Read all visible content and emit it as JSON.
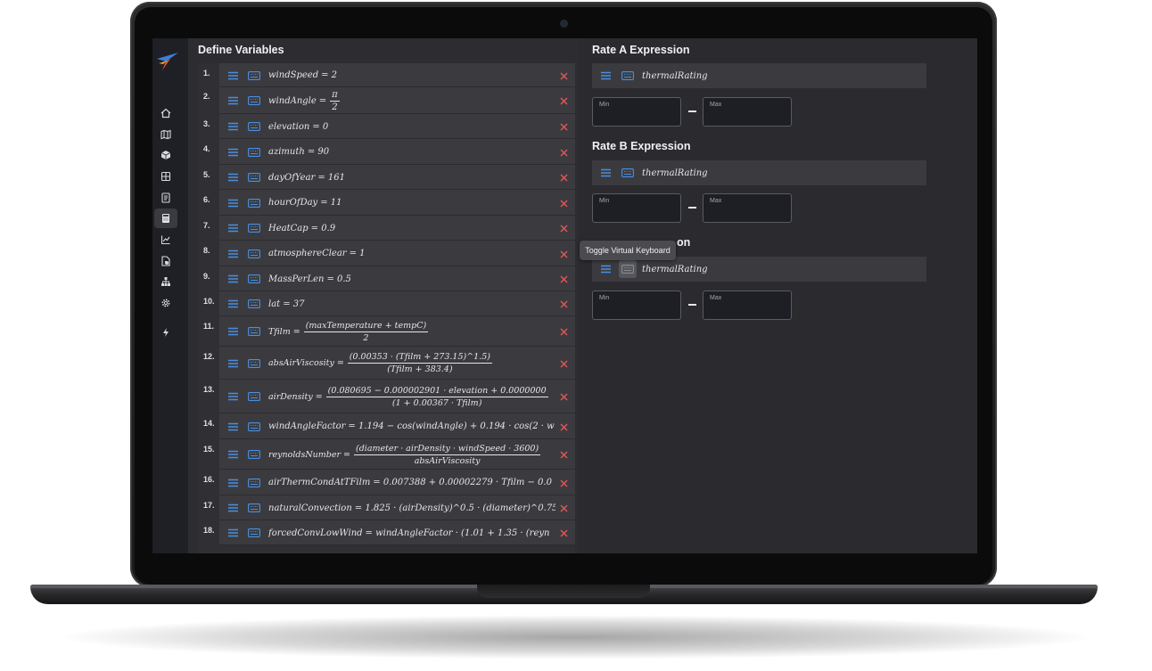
{
  "define_variables_title": "Define Variables",
  "variables": [
    {
      "num": "1.",
      "lhs": "windSpeed",
      "rhs": "= 2"
    },
    {
      "num": "2.",
      "lhs": "windAngle",
      "frac_num": "π",
      "frac_den": "2"
    },
    {
      "num": "3.",
      "lhs": "elevation",
      "rhs": "= 0"
    },
    {
      "num": "4.",
      "lhs": "azimuth",
      "rhs": "= 90"
    },
    {
      "num": "5.",
      "lhs": "dayOfYear",
      "rhs": "= 161"
    },
    {
      "num": "6.",
      "lhs": "hourOfDay",
      "rhs": "= 11"
    },
    {
      "num": "7.",
      "lhs": "HeatCap",
      "rhs": "= 0.9"
    },
    {
      "num": "8.",
      "lhs": "atmosphereClear",
      "rhs": "= 1"
    },
    {
      "num": "9.",
      "lhs": "MassPerLen",
      "rhs": "= 0.5"
    },
    {
      "num": "10.",
      "lhs": "lat",
      "rhs": "= 37"
    },
    {
      "num": "11.",
      "lhs": "Tfilm",
      "frac_num": "(maxTemperature + tempC)",
      "frac_den": "2"
    },
    {
      "num": "12.",
      "lhs": "absAirViscosity",
      "frac_num": "(0.00353 · (Tfilm + 273.15)^1.5)",
      "frac_den": "(Tfilm + 383.4)"
    },
    {
      "num": "13.",
      "lhs": "airDensity",
      "frac_num": "(0.080695 − 0.000002901 · elevation + 0.0000000",
      "frac_den": "(1 + 0.00367 · Tfilm)"
    },
    {
      "num": "14.",
      "lhs": "windAngleFactor",
      "rhs": "= 1.194 − cos(windAngle) + 0.194 · cos(2 · w"
    },
    {
      "num": "15.",
      "lhs": "reynoldsNumber",
      "frac_num": "(diameter · airDensity · windSpeed · 3600)",
      "frac_den": "absAirViscosity"
    },
    {
      "num": "16.",
      "lhs": "airThermCondAtTFilm",
      "rhs": "= 0.007388 + 0.00002279 · Tfilm − 0.0"
    },
    {
      "num": "17.",
      "lhs": "naturalConvection",
      "rhs": "= 1.825 · (airDensity)^0.5 · (diameter)^0.75 · (r"
    },
    {
      "num": "18.",
      "lhs": "forcedConvLowWind",
      "rhs": "= windAngleFactor · (1.01 + 1.35 · (reyn"
    }
  ],
  "rate_sections": [
    {
      "title": "Rate A Expression",
      "expression": "thermalRating",
      "min_label": "Min",
      "max_label": "Max"
    },
    {
      "title": "Rate B Expression",
      "expression": "thermalRating",
      "min_label": "Min",
      "max_label": "Max"
    },
    {
      "title": "",
      "title_visible_fragment": "on",
      "expression": "thermalRating",
      "min_label": "Min",
      "max_label": "Max"
    }
  ],
  "tooltip": "Toggle Virtual Keyboard",
  "icons": {
    "nav": [
      "home-icon",
      "map-icon",
      "cube-icon",
      "grid-icon",
      "document-icon",
      "calculator-icon",
      "chart-icon",
      "report-icon",
      "hierarchy-icon",
      "gear-icon",
      "bolt-icon"
    ],
    "row": [
      "menu-icon",
      "keyboard-icon",
      "close-icon"
    ]
  },
  "colors": {
    "accent_blue": "#4a8fe0",
    "close_red": "#e05555",
    "panel_bg": "#2b2b2f",
    "row_bg": "#3b3b3f"
  }
}
